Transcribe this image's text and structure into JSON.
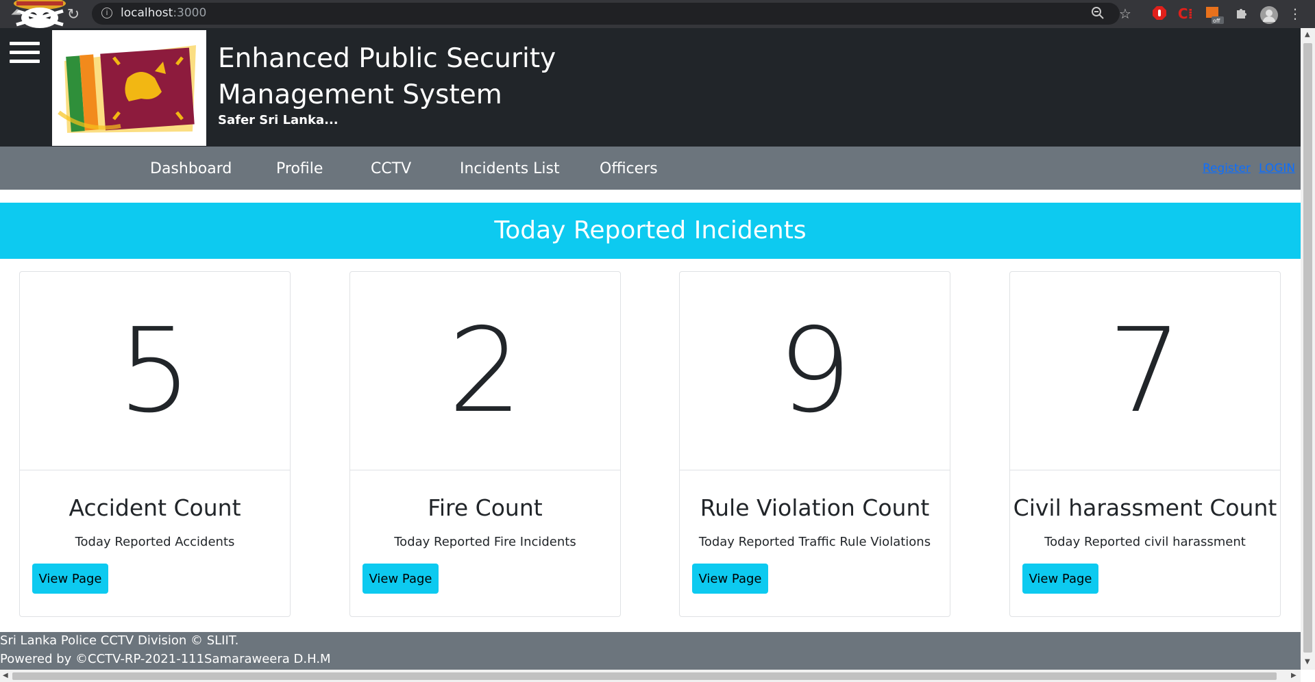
{
  "browser": {
    "url_host": "localhost",
    "url_port": ":3000"
  },
  "header": {
    "title": "Enhanced Public Security Management System",
    "tagline": "Safer Sri Lanka...",
    "logo_icon": "sri-lanka-flag-logo"
  },
  "nav": {
    "items": [
      {
        "label": "Dashboard"
      },
      {
        "label": "Profile"
      },
      {
        "label": "CCTV"
      },
      {
        "label": "Incidents List"
      },
      {
        "label": "Officers"
      }
    ],
    "register_label": "Register",
    "login_label": "LOGIN"
  },
  "banner": {
    "title": "Today Reported Incidents"
  },
  "cards": [
    {
      "count": "5",
      "title": "Accident Count",
      "subtitle": "Today Reported Accidents",
      "button": "View Page"
    },
    {
      "count": "2",
      "title": "Fire Count",
      "subtitle": "Today Reported Fire Incidents",
      "button": "View Page"
    },
    {
      "count": "9",
      "title": "Rule Violation Count",
      "subtitle": "Today Reported Traffic Rule Violations",
      "button": "View Page"
    },
    {
      "count": "7",
      "title": "Civil harassment Count",
      "subtitle": "Today Reported civil harassment",
      "button": "View Page"
    }
  ],
  "footer": {
    "line1": "Sri Lanka Police CCTV Division © SLIIT.",
    "line2": "Powered by ©CCTV-RP-2021-111Samaraweera D.H.M"
  },
  "colors": {
    "header_bg": "#212529",
    "nav_bg": "#6c757d",
    "accent": "#0dcaf0",
    "link": "#0d6efd"
  }
}
